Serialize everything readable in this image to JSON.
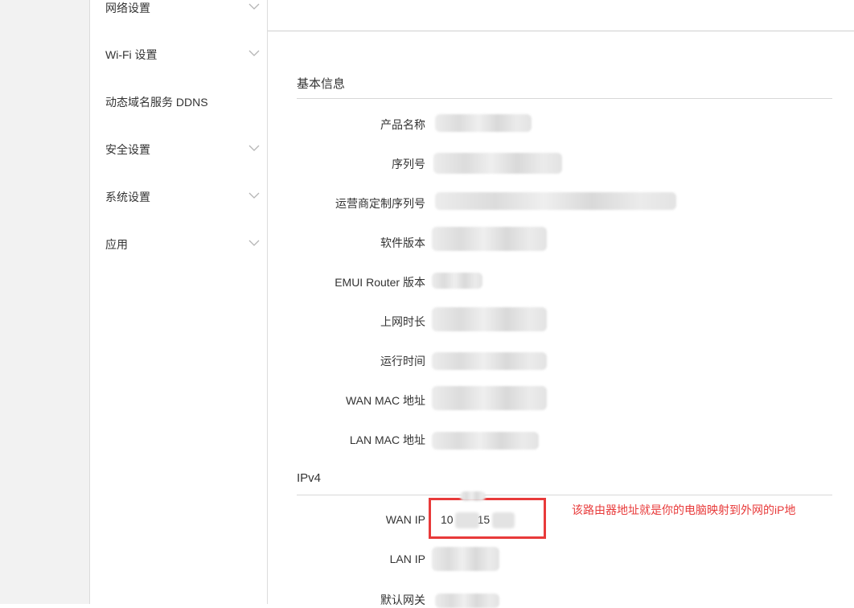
{
  "sidebar": {
    "items": [
      {
        "label": "网络设置",
        "has_submenu": true
      },
      {
        "label": "Wi-Fi 设置",
        "has_submenu": true
      },
      {
        "label": "动态域名服务 DDNS",
        "has_submenu": false
      },
      {
        "label": "安全设置",
        "has_submenu": true
      },
      {
        "label": "系统设置",
        "has_submenu": true
      },
      {
        "label": "应用",
        "has_submenu": true
      }
    ]
  },
  "basic_info": {
    "title": "基本信息",
    "rows": [
      {
        "label": "产品名称"
      },
      {
        "label": "序列号"
      },
      {
        "label": "运营商定制序列号"
      },
      {
        "label": "软件版本"
      },
      {
        "label": "EMUI Router 版本"
      },
      {
        "label": "上网时长"
      },
      {
        "label": "运行时间"
      },
      {
        "label": "WAN MAC 地址"
      },
      {
        "label": "LAN MAC 地址"
      }
    ]
  },
  "ipv4": {
    "title": "IPv4",
    "wan_ip": {
      "label": "WAN IP",
      "value_part1": "10",
      "value_part2": "15"
    },
    "lan_ip": {
      "label": "LAN IP"
    },
    "gateway": {
      "label": "默认网关"
    }
  },
  "annotation": {
    "text": "该路由器地址就是你的电脑映射到外网的iP地",
    "color": "#e83a3a"
  }
}
